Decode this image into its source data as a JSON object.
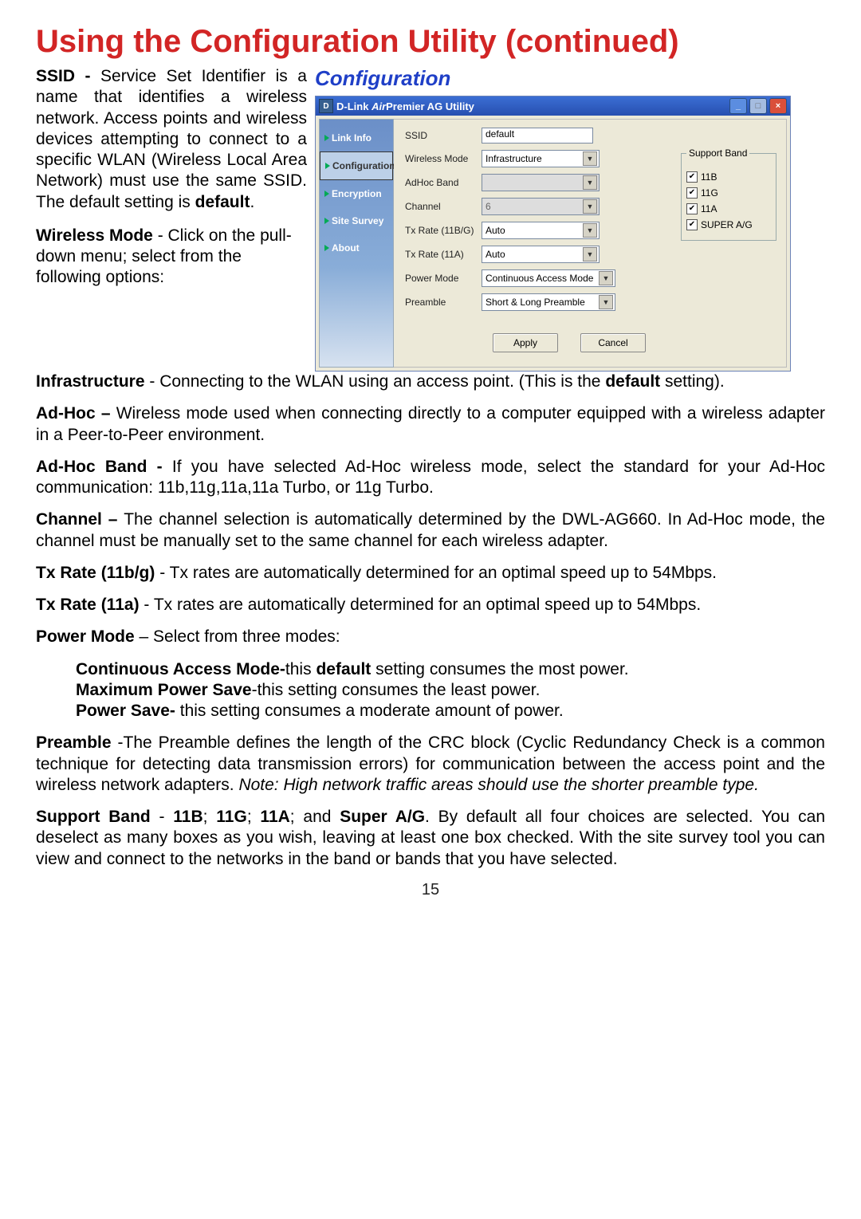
{
  "page": {
    "title": "Using the Configuration Utility (continued)",
    "section_title": "Configuration",
    "page_number": "15"
  },
  "doc": {
    "ssid_label": "SSID - ",
    "ssid_text": "Service Set Identifier is a name that identifies a wireless network. Access points and wireless devices attempting to connect to a specific WLAN (Wireless Local Area Network) must use the same SSID. The default setting is ",
    "ssid_default": "default",
    "ssid_end": ".",
    "wm_label": "Wireless Mode",
    "wm_text": " - Click on the pull-down menu; select from the following options:",
    "infra_label": "Infrastructure",
    "infra_text1": " - Connecting to the WLAN using an access point. (This is the ",
    "infra_default": "default",
    "infra_text2": " setting).",
    "adhoc_label": "Ad-Hoc – ",
    "adhoc_text": "Wireless mode used when connecting directly to a computer equipped with a wireless adapter in a Peer-to-Peer environment.",
    "adhocband_label": "Ad-Hoc Band - ",
    "adhocband_text": "If you have selected Ad-Hoc wireless mode, select the standard for your Ad-Hoc communication: 11b,11g,11a,11a Turbo, or 11g Turbo.",
    "channel_label": "Channel – ",
    "channel_text": "The channel selection is automatically determined by the DWL-AG660. In Ad-Hoc mode, the channel must be manually set to the same channel for each wireless adapter.",
    "txbg_label": "Tx Rate (11b/g)",
    "txbg_text": " -  Tx rates are automatically determined for an optimal speed up to 54Mbps.",
    "txa_label": "Tx Rate (11a)",
    "txa_text": " - Tx rates are automatically determined for an optimal speed up to 54Mbps.",
    "pm_label": "Power Mode",
    "pm_text": " – Select from three modes:",
    "cam_label": "Continuous Access Mode-",
    "cam_text_a": "this ",
    "cam_default": "default",
    "cam_text_b": " setting consumes the most power.",
    "mps_label": "Maximum Power Save",
    "mps_text": "-this setting consumes the least power.",
    "ps_label": "Power Save- ",
    "ps_text": "this setting consumes a moderate amount of power.",
    "preamble_label": "Preamble ",
    "preamble_text": "-The Preamble defines the length of the CRC block (Cyclic Redundancy Check is a common technique for detecting data transmission errors) for communication between the access point and the wireless network adapters. ",
    "preamble_note": "Note: High network traffic areas should use the shorter preamble type.",
    "sb_label": "Support Band",
    "sb_sep": " - ",
    "sb_11b": "11B",
    "sb_semi1": "; ",
    "sb_11g": "11G",
    "sb_semi2": "; ",
    "sb_11a": "11A",
    "sb_and": "; and ",
    "sb_super": "Super A/G",
    "sb_text": ". By default all four choices are selected. You can deselect as many boxes as you wish, leaving at least one box checked. With the site survey tool you can view and connect to the networks in the band or bands that you have selected."
  },
  "app": {
    "title_prefix": "D-Link ",
    "title_air": "Air",
    "title_rest": "Premier AG Utility",
    "icon_letter": "D",
    "sidebar": {
      "link_info": "Link Info",
      "configuration": "Configuration",
      "encryption": "Encryption",
      "site_survey": "Site Survey",
      "about": "About"
    },
    "labels": {
      "ssid": "SSID",
      "wireless_mode": "Wireless Mode",
      "adhoc_band": "AdHoc Band",
      "channel": "Channel",
      "tx_rate_bg": "Tx Rate (11B/G)",
      "tx_rate_a": "Tx Rate (11A)",
      "power_mode": "Power Mode",
      "preamble": "Preamble"
    },
    "values": {
      "ssid": "default",
      "wireless_mode": "Infrastructure",
      "adhoc_band": "",
      "channel": "6",
      "tx_rate_bg": "Auto",
      "tx_rate_a": "Auto",
      "power_mode": "Continuous Access Mode",
      "preamble": "Short & Long Preamble"
    },
    "support_band": {
      "legend": "Support Band",
      "b": "11B",
      "g": "11G",
      "a": "11A",
      "super": "SUPER A/G"
    },
    "buttons": {
      "apply": "Apply",
      "cancel": "Cancel"
    }
  }
}
